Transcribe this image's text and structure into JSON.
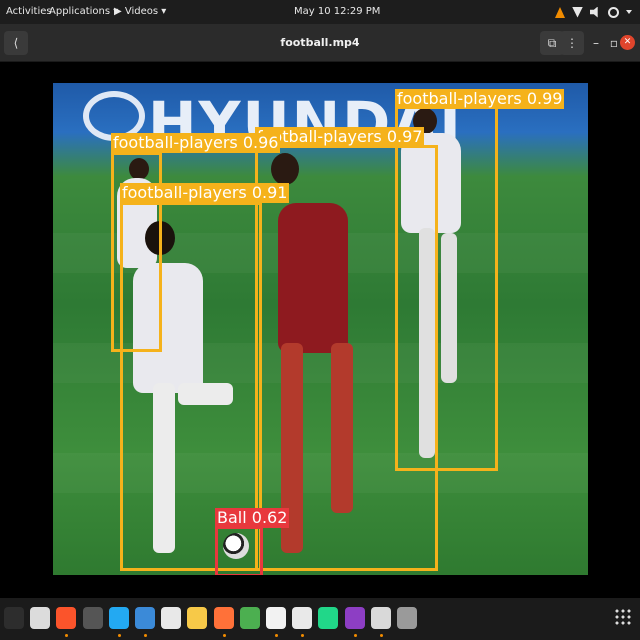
{
  "topbar": {
    "activities": "Activities",
    "applications": "Applications ▾",
    "videos": "▶ Videos ▾",
    "clock": "May 10  12:29 PM",
    "tray_icons": [
      "vlc-cone-icon",
      "wifi-icon",
      "volume-icon",
      "power-icon",
      "chevron-down-icon"
    ]
  },
  "header": {
    "back": "⟨",
    "title": "football.mp4",
    "pip": "⧉",
    "menu": "⋮",
    "minimize": "–",
    "maximize": "▫",
    "close": "✕"
  },
  "video": {
    "banner": "HYUNDAI",
    "detections": [
      {
        "label": "football-players 0.99"
      },
      {
        "label": "football-players 0.97"
      },
      {
        "label": "football-players 0.96"
      },
      {
        "label": "football-players 0.91"
      },
      {
        "label": "Ball 0.62"
      }
    ]
  },
  "dock": {
    "apps": [
      "terminal-icon",
      "files-icon",
      "brave-icon",
      "obs-icon",
      "vscode-icon",
      "settings-icon",
      "rhythmbox-icon",
      "screenshot-icon",
      "firefox-icon",
      "chrome-icon",
      "text-editor-icon",
      "pdf-viewer-icon",
      "pycharm-icon",
      "video-player-icon",
      "image-viewer-icon",
      "trash-icon"
    ],
    "colors": [
      "#2d2d2d",
      "#dcdcdc",
      "#fb542b",
      "#555555",
      "#23a9f2",
      "#3b8ad8",
      "#e8e8e8",
      "#f7c948",
      "#ff7139",
      "#4caf50",
      "#f2f2f2",
      "#e9e9e9",
      "#21d789",
      "#8d3ec4",
      "#d9d9d9",
      "#9a9a9a"
    ]
  }
}
